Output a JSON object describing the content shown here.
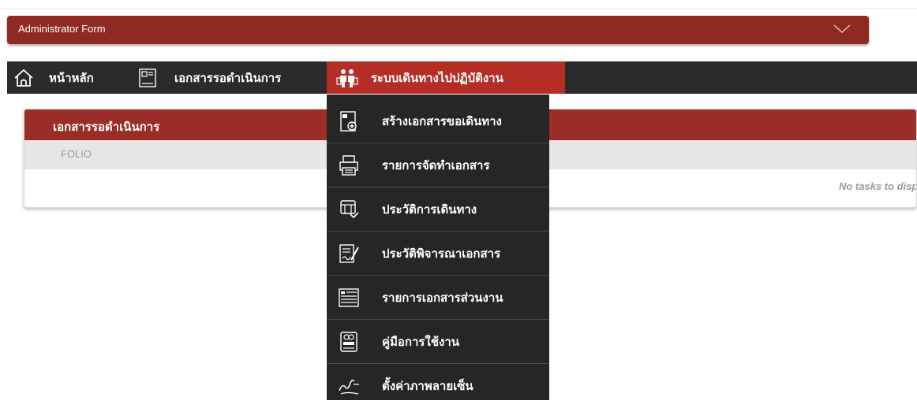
{
  "admin_bar": {
    "title": "Administrator Form",
    "icon": "chevron-down-icon"
  },
  "nav": {
    "items": [
      {
        "label": "หน้าหลัก",
        "icon": "home-icon"
      },
      {
        "label": "เอกสารรอดำเนินการ",
        "icon": "document-icon"
      },
      {
        "label": "ระบบเดินทางไปปฏิบัติงาน",
        "icon": "travelers-icon",
        "active": true
      }
    ],
    "active_color": "#b52d25"
  },
  "panel": {
    "title": "เอกสารรอดำเนินการ",
    "column_header": "FOLIO",
    "empty_message": "No tasks to displ"
  },
  "dropdown": {
    "items": [
      {
        "label": "สร้างเอกสารขอเดินทาง",
        "icon": "new-document-icon"
      },
      {
        "label": "รายการจัดทำเอกสาร",
        "icon": "printer-icon"
      },
      {
        "label": "ประวัติการเดินทาง",
        "icon": "travel-history-icon"
      },
      {
        "label": "ประวัติพิจารณาเอกสาร",
        "icon": "document-sign-icon"
      },
      {
        "label": "รายการเอกสารส่วนงาน",
        "icon": "document-list-icon"
      },
      {
        "label": "คู่มือการใช้งาน",
        "icon": "guide-icon"
      },
      {
        "label": "ตั้งค่าภาพลายเซ็น",
        "icon": "signature-icon"
      }
    ]
  },
  "colors": {
    "brand": "#8e2a22",
    "nav_bg": "#2b2b2b",
    "menu_bg": "#262626"
  }
}
